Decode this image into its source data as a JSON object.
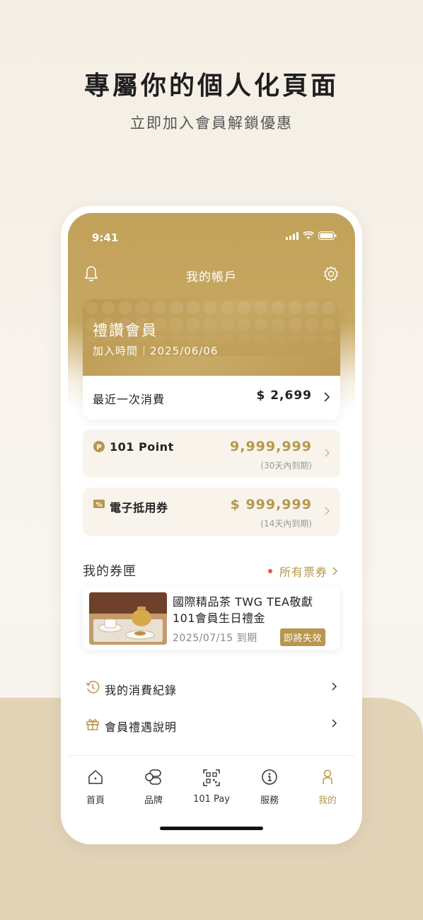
{
  "promo": {
    "headline": "專屬你的個人化頁面",
    "subline": "立即加入會員解鎖優惠"
  },
  "status_bar": {
    "time": "9:41"
  },
  "header": {
    "title": "我的帳戶"
  },
  "member_card": {
    "level": "禮讚會員",
    "join_label": "加入時間",
    "join_date": "2025/06/06",
    "last_purchase_label": "最近一次消費",
    "last_purchase_amount": "$ 2,699"
  },
  "points": {
    "label": "101 Point",
    "value": "9,999,999",
    "note": "(30天內到期)"
  },
  "vouchers": {
    "label": "電子抵用券",
    "value": "$ 999,999",
    "note": "(14天內到期)"
  },
  "wallet": {
    "title": "我的券匣",
    "all_link": "所有票券",
    "coupon": {
      "title": "國際精品茶 TWG TEA敬獻101會員生日禮金",
      "expiry": "2025/07/15 到期",
      "badge": "即將失效"
    }
  },
  "menu": [
    {
      "label": "我的消費紀錄",
      "icon": "history-icon"
    },
    {
      "label": "會員禮遇說明",
      "icon": "gift-icon"
    },
    {
      "label": "設定",
      "icon": "settings-icon"
    }
  ],
  "tabbar": [
    {
      "label": "首頁",
      "icon": "home-icon"
    },
    {
      "label": "品牌",
      "icon": "brand-icon"
    },
    {
      "label": "101 Pay",
      "icon": "qr-icon"
    },
    {
      "label": "服務",
      "icon": "info-icon"
    },
    {
      "label": "我的",
      "icon": "person-icon",
      "active": true
    }
  ],
  "colors": {
    "gold": "#b8964e",
    "badge_red_dot": "#e0584f"
  }
}
